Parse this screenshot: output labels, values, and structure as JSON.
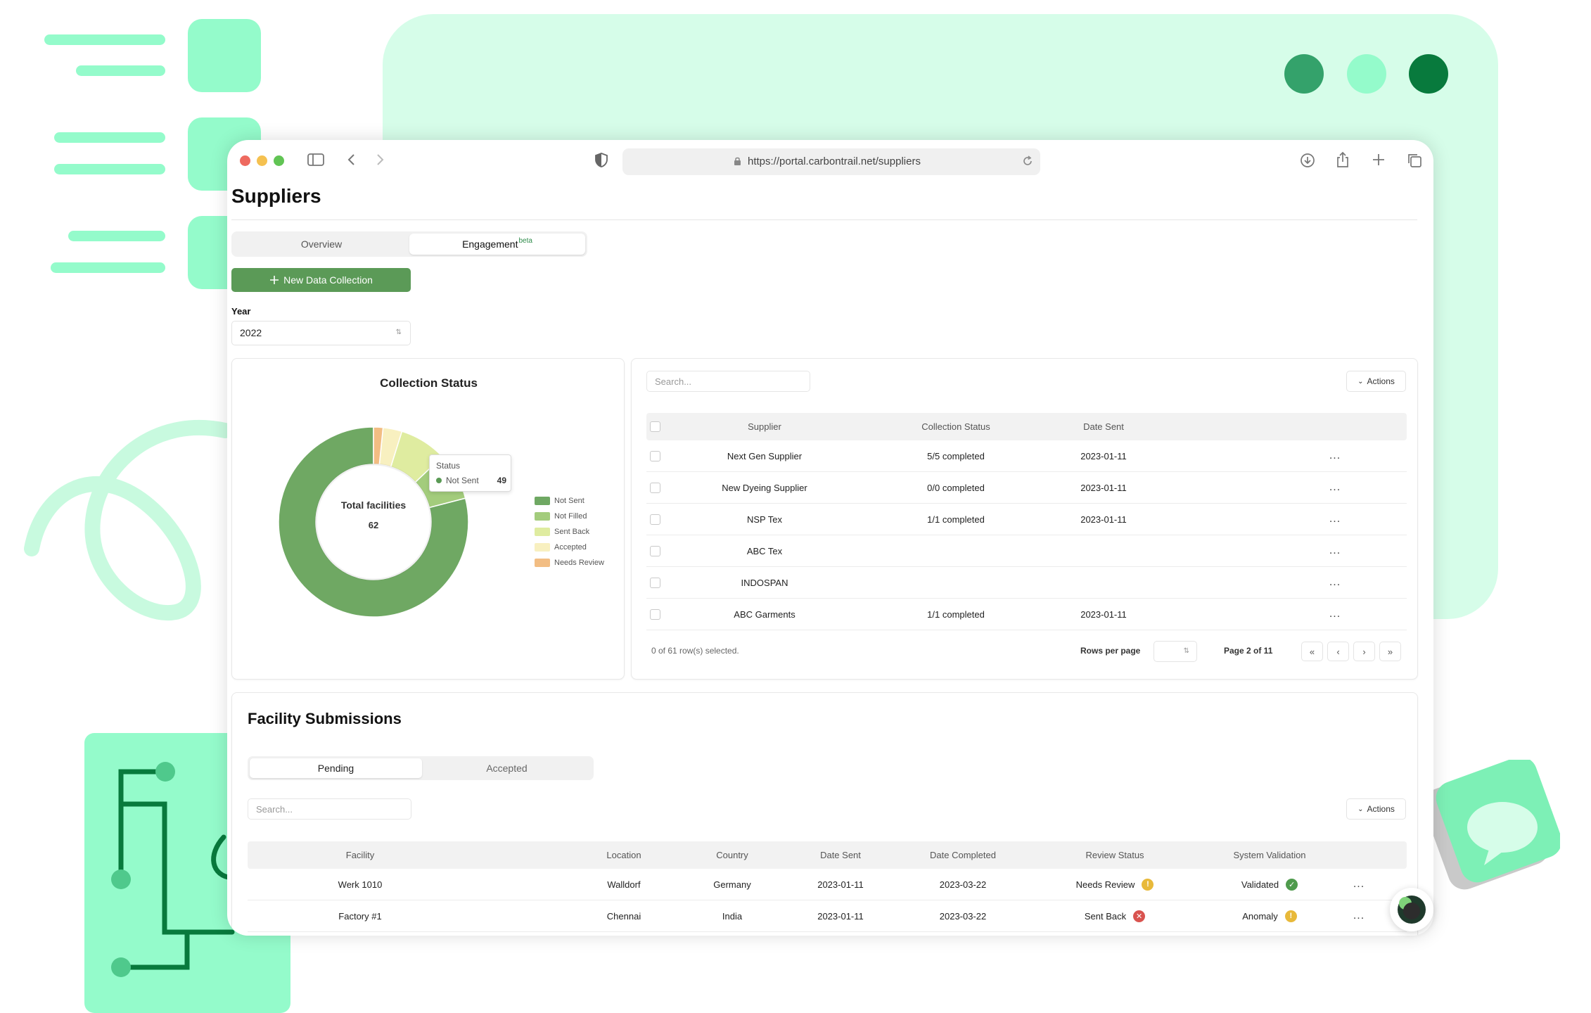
{
  "browser": {
    "url": "https://portal.carbontrail.net/suppliers"
  },
  "page": {
    "title": "Suppliers",
    "tabs": [
      {
        "label": "Overview",
        "active": false
      },
      {
        "label": "Engagement",
        "badge": "beta",
        "active": true
      }
    ],
    "new_button": "New Data Collection",
    "year_label": "Year",
    "year_value": "2022"
  },
  "collection_status": {
    "title": "Collection Status",
    "center_label": "Total facilities",
    "center_value": "62",
    "tooltip": {
      "title": "Status",
      "label": "Not Sent",
      "value": "49"
    },
    "legend": [
      {
        "label": "Not Sent",
        "color": "#6fa863"
      },
      {
        "label": "Not Filled",
        "color": "#a3cc7c"
      },
      {
        "label": "Sent Back",
        "color": "#dfeca0"
      },
      {
        "label": "Accepted",
        "color": "#f8f0c0"
      },
      {
        "label": "Needs Review",
        "color": "#f2bd83"
      }
    ]
  },
  "chart_data": {
    "type": "pie",
    "title": "Collection Status",
    "categories": [
      "Not Sent",
      "Not Filled",
      "Sent Back",
      "Accepted",
      "Needs Review"
    ],
    "values": [
      49,
      5,
      5,
      2,
      1
    ],
    "colors": [
      "#6fa863",
      "#a3cc7c",
      "#dfeca0",
      "#f8f0c0",
      "#f2bd83"
    ],
    "legend": "right"
  },
  "suppliers": {
    "search_placeholder": "Search...",
    "actions_label": "Actions",
    "columns": [
      "Supplier",
      "Collection Status",
      "Date Sent"
    ],
    "rows": [
      {
        "supplier": "Next Gen Supplier",
        "status": "5/5 completed",
        "date": "2023-01-11"
      },
      {
        "supplier": "New Dyeing Supplier",
        "status": "0/0 completed",
        "date": "2023-01-11"
      },
      {
        "supplier": "NSP Tex",
        "status": "1/1 completed",
        "date": "2023-01-11"
      },
      {
        "supplier": "ABC Tex",
        "status": "",
        "date": ""
      },
      {
        "supplier": "INDOSPAN",
        "status": "",
        "date": ""
      },
      {
        "supplier": "ABC Garments",
        "status": "1/1 completed",
        "date": "2023-01-11"
      }
    ],
    "row_menu": "...",
    "selection": "0 of 61 row(s) selected.",
    "rows_per_page_label": "Rows per page",
    "page_label": "Page 2 of 11",
    "pager": {
      "first": "«",
      "prev": "‹",
      "next": "›",
      "last": "»"
    }
  },
  "facility_submissions": {
    "title": "Facility Submissions",
    "tabs": [
      {
        "label": "Pending",
        "active": true
      },
      {
        "label": "Accepted",
        "active": false
      }
    ],
    "search_placeholder": "Search...",
    "actions_label": "Actions",
    "columns": [
      "Facility",
      "Location",
      "Country",
      "Date Sent",
      "Date Completed",
      "Review Status",
      "System Validation"
    ],
    "rows": [
      {
        "facility": "Werk 1010",
        "location": "Walldorf",
        "country": "Germany",
        "date_sent": "2023-01-11",
        "date_completed": "2023-03-22",
        "review": "Needs Review",
        "review_icon": "warning-icon",
        "validation": "Validated",
        "validation_icon": "check-icon"
      },
      {
        "facility": "Factory #1",
        "location": "Chennai",
        "country": "India",
        "date_sent": "2023-01-11",
        "date_completed": "2023-03-22",
        "review": "Sent Back",
        "review_icon": "error-icon",
        "validation": "Anomaly",
        "validation_icon": "warning-icon"
      }
    ],
    "row_menu": "..."
  },
  "colors": {
    "accent": "#5b9a57",
    "mint": "#94fbcb",
    "mint_light": "#d6fde9",
    "warning": "#e8b93a",
    "error": "#d9534f",
    "success": "#4f9b4d"
  }
}
